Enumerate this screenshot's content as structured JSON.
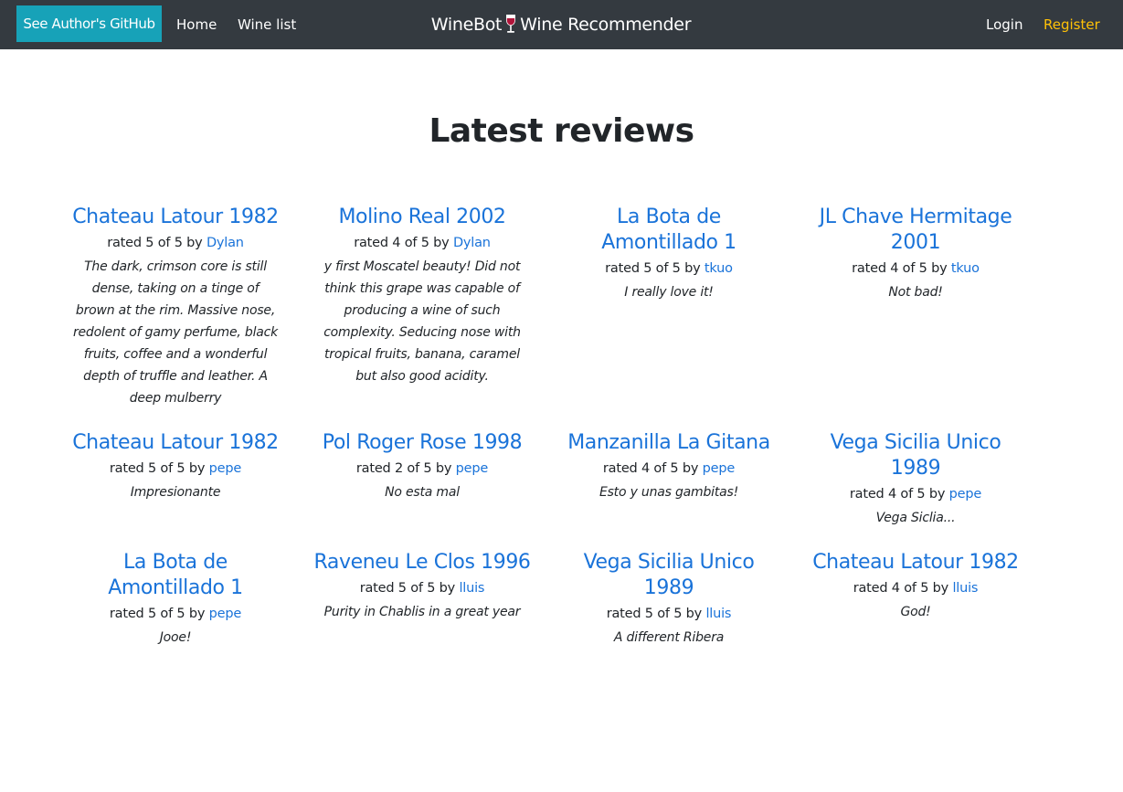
{
  "nav": {
    "github_label": "See Author's GitHub",
    "home_label": "Home",
    "winelist_label": "Wine list",
    "brand_left": "WineBot",
    "brand_right": "Wine Recommender",
    "login_label": "Login",
    "register_label": "Register",
    "brand_icon": "wine-glass-icon"
  },
  "main": {
    "title": "Latest reviews"
  },
  "colors": {
    "navbar": "#343a40",
    "github_button": "#17a2b8",
    "link": "#1a73d9",
    "register": "#ffc107"
  },
  "reviews": [
    {
      "wine": "Chateau Latour 1982",
      "rated_prefix": "rated 5 of 5 by",
      "user": "Dylan",
      "text": "The dark, crimson core is still dense, taking on a tinge of brown at the rim. Massive nose, redolent of gamy perfume, black fruits, coffee and a wonderful depth of truffle and leather. A deep mulberry"
    },
    {
      "wine": "Molino Real 2002",
      "rated_prefix": "rated 4 of 5 by",
      "user": "Dylan",
      "text": "y first Moscatel beauty! Did not think this grape was capable of producing a wine of such complexity. Seducing nose with tropical fruits, banana, caramel but also good acidity."
    },
    {
      "wine": "La Bota de Amontillado 1",
      "rated_prefix": "rated 5 of 5 by",
      "user": "tkuo",
      "text": "I really love it!"
    },
    {
      "wine": "JL Chave Hermitage 2001",
      "rated_prefix": "rated 4 of 5 by",
      "user": "tkuo",
      "text": "Not bad!"
    },
    {
      "wine": "Chateau Latour 1982",
      "rated_prefix": "rated 5 of 5 by",
      "user": "pepe",
      "text": "Impresionante"
    },
    {
      "wine": "Pol Roger Rose 1998",
      "rated_prefix": "rated 2 of 5 by",
      "user": "pepe",
      "text": "No esta mal"
    },
    {
      "wine": "Manzanilla La Gitana",
      "rated_prefix": "rated 4 of 5 by",
      "user": "pepe",
      "text": "Esto y unas gambitas!"
    },
    {
      "wine": "Vega Sicilia Unico 1989",
      "rated_prefix": "rated 4 of 5 by",
      "user": "pepe",
      "text": "Vega Siclia..."
    },
    {
      "wine": "La Bota de Amontillado 1",
      "rated_prefix": "rated 5 of 5 by",
      "user": "pepe",
      "text": "Jooe!"
    },
    {
      "wine": "Raveneu Le Clos 1996",
      "rated_prefix": "rated 5 of 5 by",
      "user": "lluis",
      "text": "Purity in Chablis in a great year"
    },
    {
      "wine": "Vega Sicilia Unico 1989",
      "rated_prefix": "rated 5 of 5 by",
      "user": "lluis",
      "text": "A different Ribera"
    },
    {
      "wine": "Chateau Latour 1982",
      "rated_prefix": "rated 4 of 5 by",
      "user": "lluis",
      "text": "God!"
    }
  ]
}
